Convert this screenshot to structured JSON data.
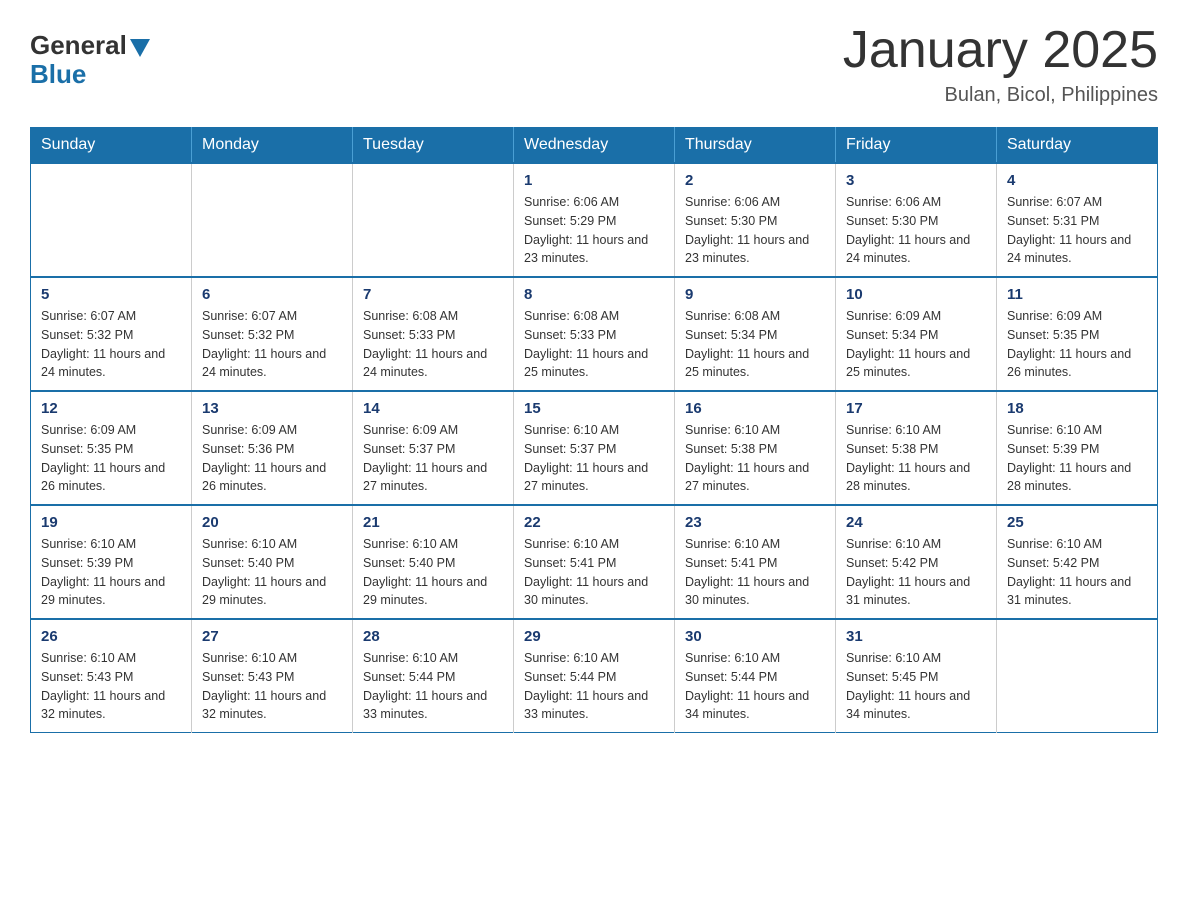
{
  "header": {
    "logo_general": "General",
    "logo_blue": "Blue",
    "title": "January 2025",
    "subtitle": "Bulan, Bicol, Philippines"
  },
  "days_of_week": [
    "Sunday",
    "Monday",
    "Tuesday",
    "Wednesday",
    "Thursday",
    "Friday",
    "Saturday"
  ],
  "weeks": [
    {
      "days": [
        {
          "num": "",
          "info": ""
        },
        {
          "num": "",
          "info": ""
        },
        {
          "num": "",
          "info": ""
        },
        {
          "num": "1",
          "info": "Sunrise: 6:06 AM\nSunset: 5:29 PM\nDaylight: 11 hours and 23 minutes."
        },
        {
          "num": "2",
          "info": "Sunrise: 6:06 AM\nSunset: 5:30 PM\nDaylight: 11 hours and 23 minutes."
        },
        {
          "num": "3",
          "info": "Sunrise: 6:06 AM\nSunset: 5:30 PM\nDaylight: 11 hours and 24 minutes."
        },
        {
          "num": "4",
          "info": "Sunrise: 6:07 AM\nSunset: 5:31 PM\nDaylight: 11 hours and 24 minutes."
        }
      ]
    },
    {
      "days": [
        {
          "num": "5",
          "info": "Sunrise: 6:07 AM\nSunset: 5:32 PM\nDaylight: 11 hours and 24 minutes."
        },
        {
          "num": "6",
          "info": "Sunrise: 6:07 AM\nSunset: 5:32 PM\nDaylight: 11 hours and 24 minutes."
        },
        {
          "num": "7",
          "info": "Sunrise: 6:08 AM\nSunset: 5:33 PM\nDaylight: 11 hours and 24 minutes."
        },
        {
          "num": "8",
          "info": "Sunrise: 6:08 AM\nSunset: 5:33 PM\nDaylight: 11 hours and 25 minutes."
        },
        {
          "num": "9",
          "info": "Sunrise: 6:08 AM\nSunset: 5:34 PM\nDaylight: 11 hours and 25 minutes."
        },
        {
          "num": "10",
          "info": "Sunrise: 6:09 AM\nSunset: 5:34 PM\nDaylight: 11 hours and 25 minutes."
        },
        {
          "num": "11",
          "info": "Sunrise: 6:09 AM\nSunset: 5:35 PM\nDaylight: 11 hours and 26 minutes."
        }
      ]
    },
    {
      "days": [
        {
          "num": "12",
          "info": "Sunrise: 6:09 AM\nSunset: 5:35 PM\nDaylight: 11 hours and 26 minutes."
        },
        {
          "num": "13",
          "info": "Sunrise: 6:09 AM\nSunset: 5:36 PM\nDaylight: 11 hours and 26 minutes."
        },
        {
          "num": "14",
          "info": "Sunrise: 6:09 AM\nSunset: 5:37 PM\nDaylight: 11 hours and 27 minutes."
        },
        {
          "num": "15",
          "info": "Sunrise: 6:10 AM\nSunset: 5:37 PM\nDaylight: 11 hours and 27 minutes."
        },
        {
          "num": "16",
          "info": "Sunrise: 6:10 AM\nSunset: 5:38 PM\nDaylight: 11 hours and 27 minutes."
        },
        {
          "num": "17",
          "info": "Sunrise: 6:10 AM\nSunset: 5:38 PM\nDaylight: 11 hours and 28 minutes."
        },
        {
          "num": "18",
          "info": "Sunrise: 6:10 AM\nSunset: 5:39 PM\nDaylight: 11 hours and 28 minutes."
        }
      ]
    },
    {
      "days": [
        {
          "num": "19",
          "info": "Sunrise: 6:10 AM\nSunset: 5:39 PM\nDaylight: 11 hours and 29 minutes."
        },
        {
          "num": "20",
          "info": "Sunrise: 6:10 AM\nSunset: 5:40 PM\nDaylight: 11 hours and 29 minutes."
        },
        {
          "num": "21",
          "info": "Sunrise: 6:10 AM\nSunset: 5:40 PM\nDaylight: 11 hours and 29 minutes."
        },
        {
          "num": "22",
          "info": "Sunrise: 6:10 AM\nSunset: 5:41 PM\nDaylight: 11 hours and 30 minutes."
        },
        {
          "num": "23",
          "info": "Sunrise: 6:10 AM\nSunset: 5:41 PM\nDaylight: 11 hours and 30 minutes."
        },
        {
          "num": "24",
          "info": "Sunrise: 6:10 AM\nSunset: 5:42 PM\nDaylight: 11 hours and 31 minutes."
        },
        {
          "num": "25",
          "info": "Sunrise: 6:10 AM\nSunset: 5:42 PM\nDaylight: 11 hours and 31 minutes."
        }
      ]
    },
    {
      "days": [
        {
          "num": "26",
          "info": "Sunrise: 6:10 AM\nSunset: 5:43 PM\nDaylight: 11 hours and 32 minutes."
        },
        {
          "num": "27",
          "info": "Sunrise: 6:10 AM\nSunset: 5:43 PM\nDaylight: 11 hours and 32 minutes."
        },
        {
          "num": "28",
          "info": "Sunrise: 6:10 AM\nSunset: 5:44 PM\nDaylight: 11 hours and 33 minutes."
        },
        {
          "num": "29",
          "info": "Sunrise: 6:10 AM\nSunset: 5:44 PM\nDaylight: 11 hours and 33 minutes."
        },
        {
          "num": "30",
          "info": "Sunrise: 6:10 AM\nSunset: 5:44 PM\nDaylight: 11 hours and 34 minutes."
        },
        {
          "num": "31",
          "info": "Sunrise: 6:10 AM\nSunset: 5:45 PM\nDaylight: 11 hours and 34 minutes."
        },
        {
          "num": "",
          "info": ""
        }
      ]
    }
  ]
}
